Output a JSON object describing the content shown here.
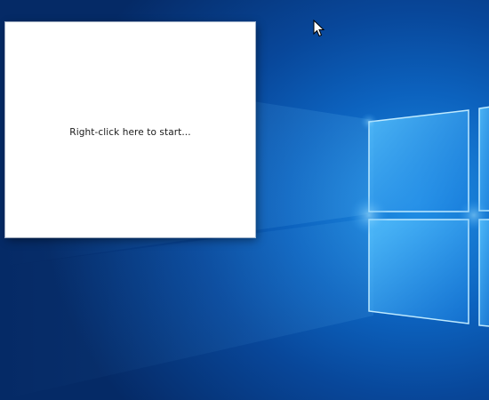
{
  "window": {
    "prompt_text": "Right-click here to start..."
  }
}
